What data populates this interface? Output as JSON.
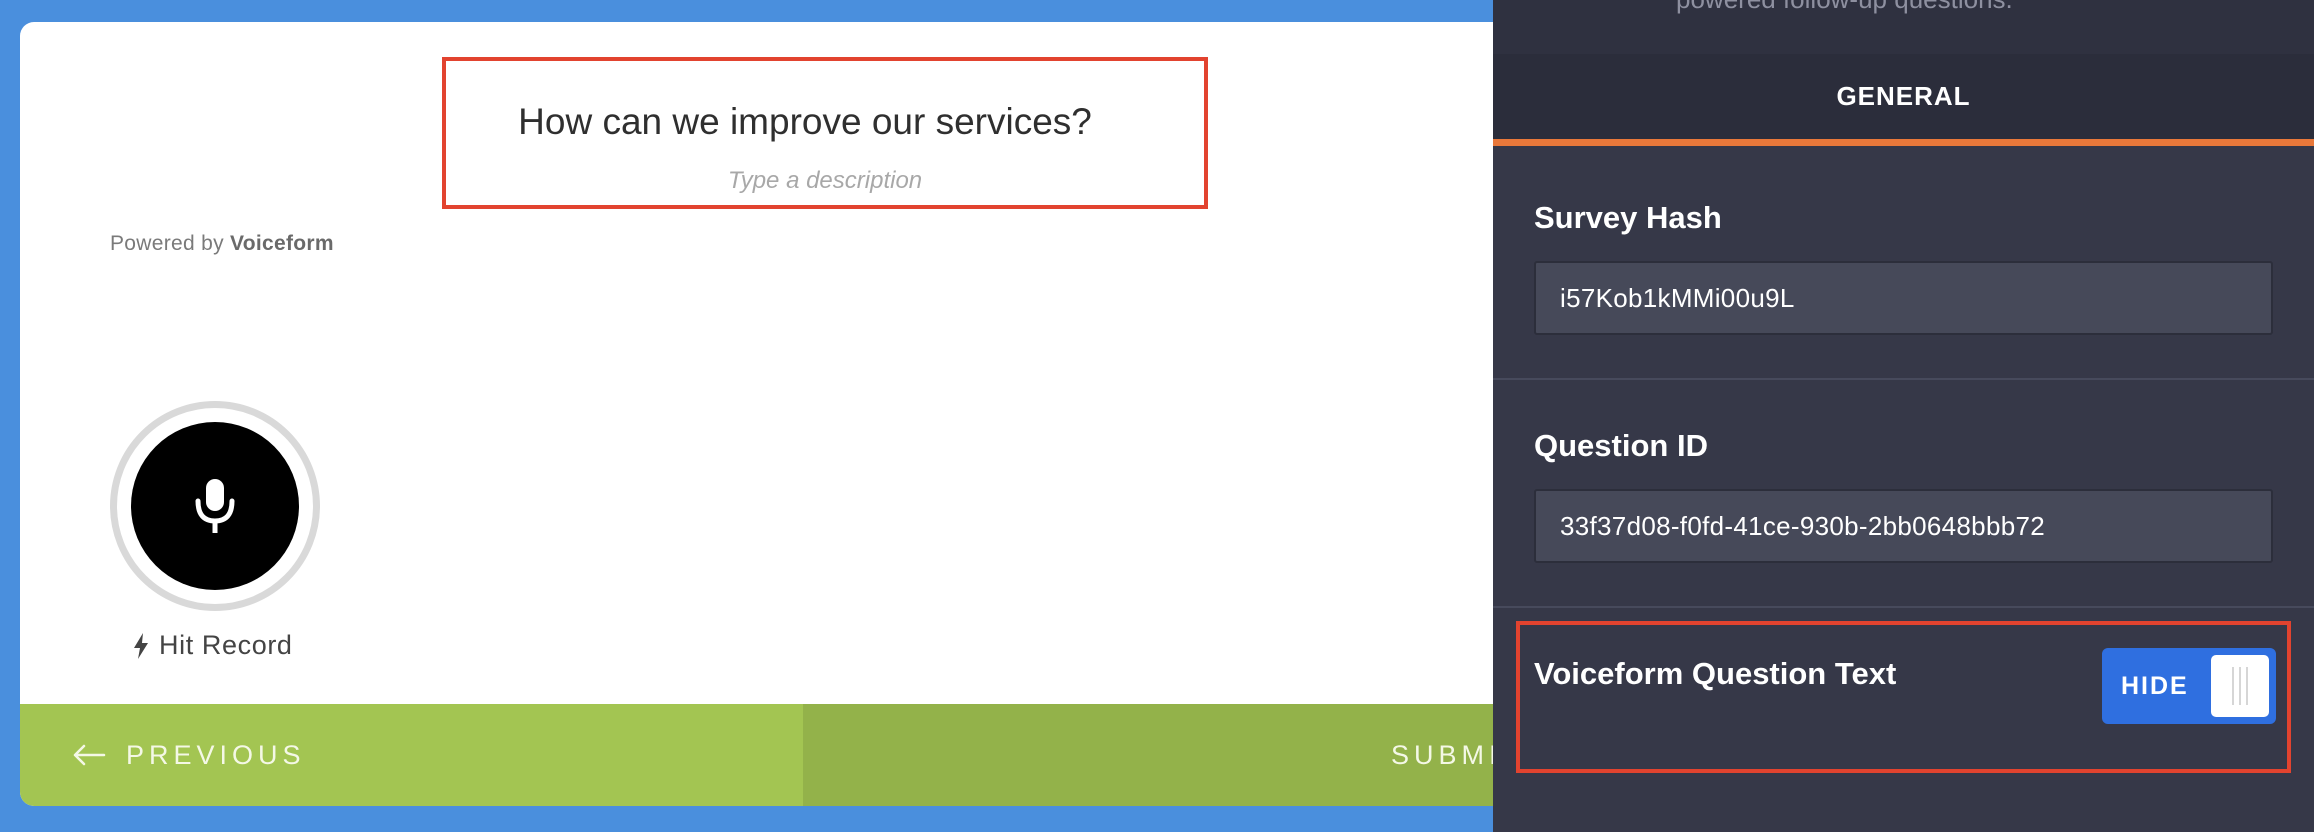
{
  "survey": {
    "question_title": "How can we improve our services?",
    "question_description": "Type a description",
    "powered_prefix": "Powered by",
    "powered_brand": "Voiceform",
    "record_label": "Hit Record",
    "previous_label": "PREVIOUS",
    "submit_label": "SUBMIT"
  },
  "panel": {
    "top_text": "powered follow-up questions.",
    "tab_general": "GENERAL",
    "survey_hash_label": "Survey Hash",
    "survey_hash_value": "i57Kob1kMMi00u9L",
    "question_id_label": "Question ID",
    "question_id_value": "33f37d08-f0fd-41ce-930b-2bb0648bbb72",
    "question_text_label": "Voiceform Question Text",
    "toggle_label": "HIDE"
  },
  "colors": {
    "background": "#4a8fdd",
    "highlight": "#e2432f",
    "previous_button": "#a3c552",
    "submit_button": "#93b24a",
    "panel": "#363848",
    "tab_accent": "#e9783a",
    "toggle": "#2f6fe0"
  },
  "icons": [
    "microphone-icon",
    "lightning-icon",
    "arrow-left-icon",
    "grip-icon"
  ]
}
